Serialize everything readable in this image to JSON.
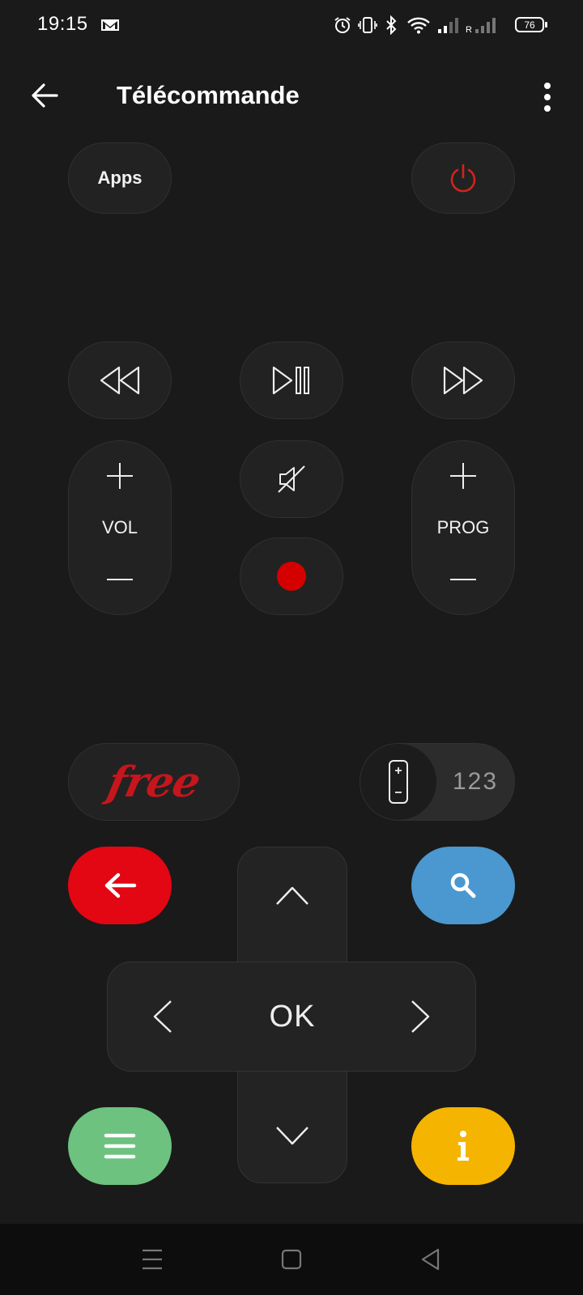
{
  "status_bar": {
    "time": "19:15",
    "battery": "76",
    "icons": [
      "gmail-icon",
      "alarm-icon",
      "vibrate-icon",
      "bluetooth-icon",
      "wifi-icon",
      "signal-icon",
      "roaming-signal-icon"
    ],
    "roaming_label": "R"
  },
  "header": {
    "title": "Télécommande",
    "back_icon": "arrow-left-icon",
    "menu_icon": "more-vertical-icon"
  },
  "remote": {
    "apps_label": "Apps",
    "vol_label": "VOL",
    "prog_label": "PROG",
    "ok_label": "OK",
    "numpad_label": "123",
    "brand_logo": "free",
    "colors": {
      "red": "#e30613",
      "blue": "#4a98cf",
      "green": "#6cc27e",
      "yellow": "#f5b400",
      "record": "#d40000",
      "power": "#d3231b"
    }
  },
  "nav_bar": {
    "icons": [
      "recent-apps-icon",
      "home-icon",
      "back-icon"
    ]
  }
}
